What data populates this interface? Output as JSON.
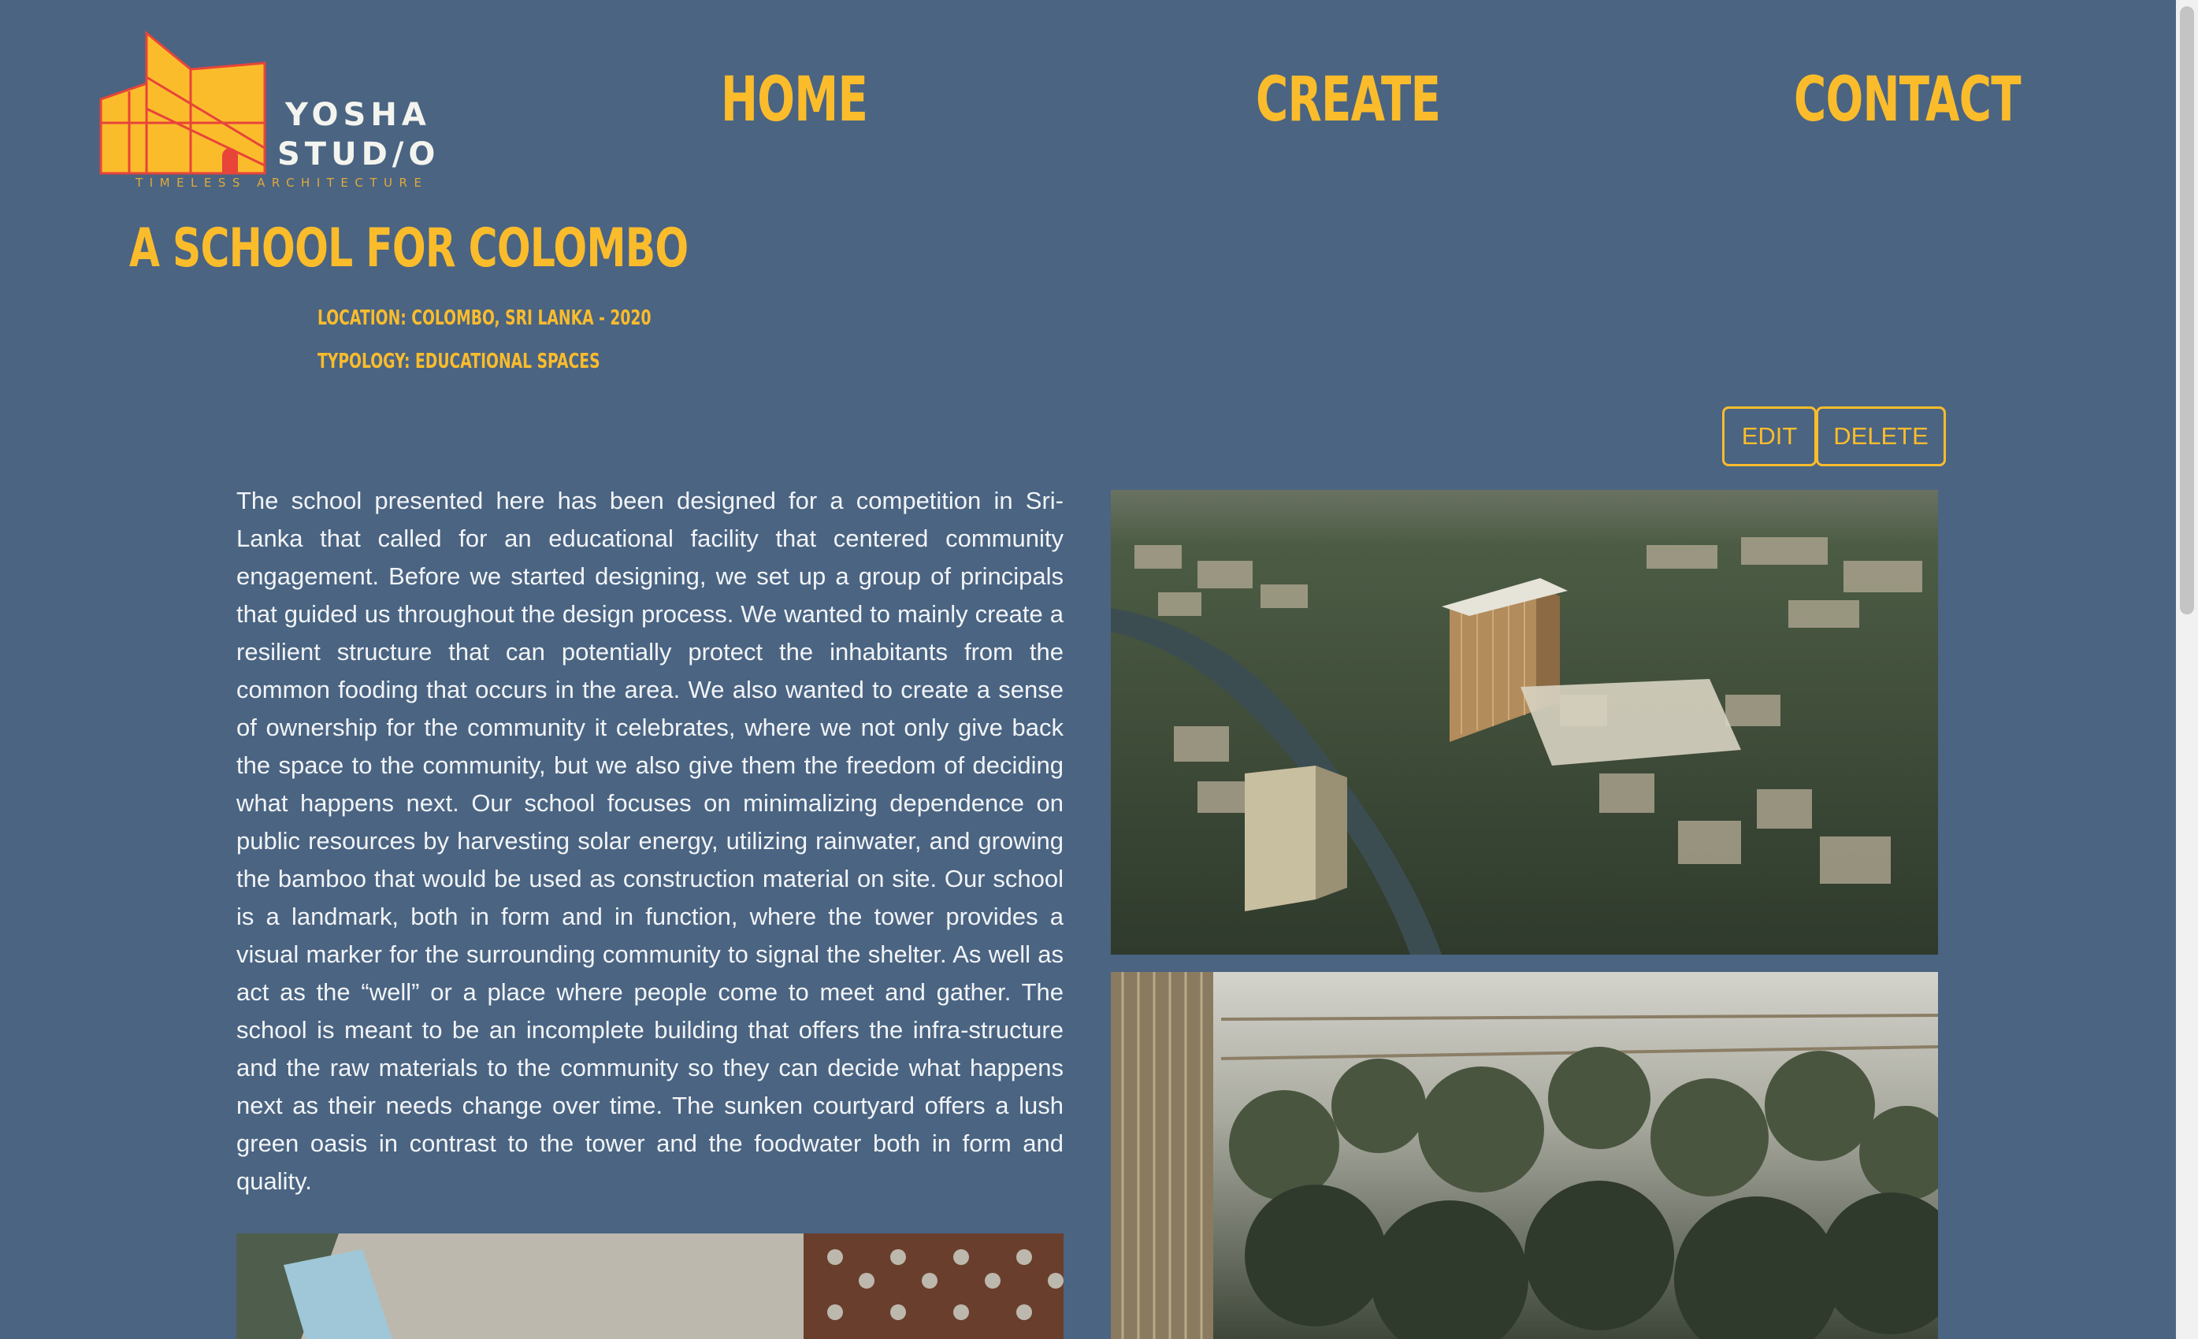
{
  "brand": {
    "name_line1": "YOSHA",
    "name_line2": "STUD/O",
    "tagline": "TIMELESS ARCHITECTURE",
    "logo_color": "#fbbc2c",
    "logo_line_color": "#e8443a"
  },
  "nav": {
    "items": [
      {
        "label": "HOME"
      },
      {
        "label": "CREATE"
      },
      {
        "label": "CONTACT"
      }
    ]
  },
  "project": {
    "title": "A SCHOOL FOR COLOMBO",
    "location": "LOCATION: COLOMBO, SRI LANKA - 2020",
    "typology": "TYPOLOGY: EDUCATIONAL SPACES",
    "description": "The school presented here has been designed for a competition in Sri-Lanka that called for an educational facility that centered community engagement. Before we started designing, we set up a group of principals that guided us throughout the design process. We wanted to mainly create a resilient structure that can potentially protect the inhabitants from the common fooding that occurs in the area. We also wanted to create a sense of ownership for the community it celebrates, where we not only give back the space to the community, but we also give them the freedom of deciding what happens next. Our school focuses on minimalizing dependence on public resources by harvesting solar energy, utilizing rainwater, and growing the bamboo that would be used as construction material on site. Our school is a landmark, both in form and in function, where the tower provides a visual marker for the surrounding community to signal the shelter. As well as act as the “well” or a place where people come to meet and gather. The school is meant to be an incomplete building that offers the infra-structure and the raw materials to the community so they can decide what happens next as their needs change over time. The sunken courtyard offers a lush green oasis in contrast to the tower and the foodwater both in form and quality."
  },
  "actions": {
    "edit_label": "EDIT",
    "delete_label": "DELETE"
  },
  "theme": {
    "background": "#4a6482",
    "accent": "#fbbc2c",
    "text": "#f2f4f7"
  }
}
